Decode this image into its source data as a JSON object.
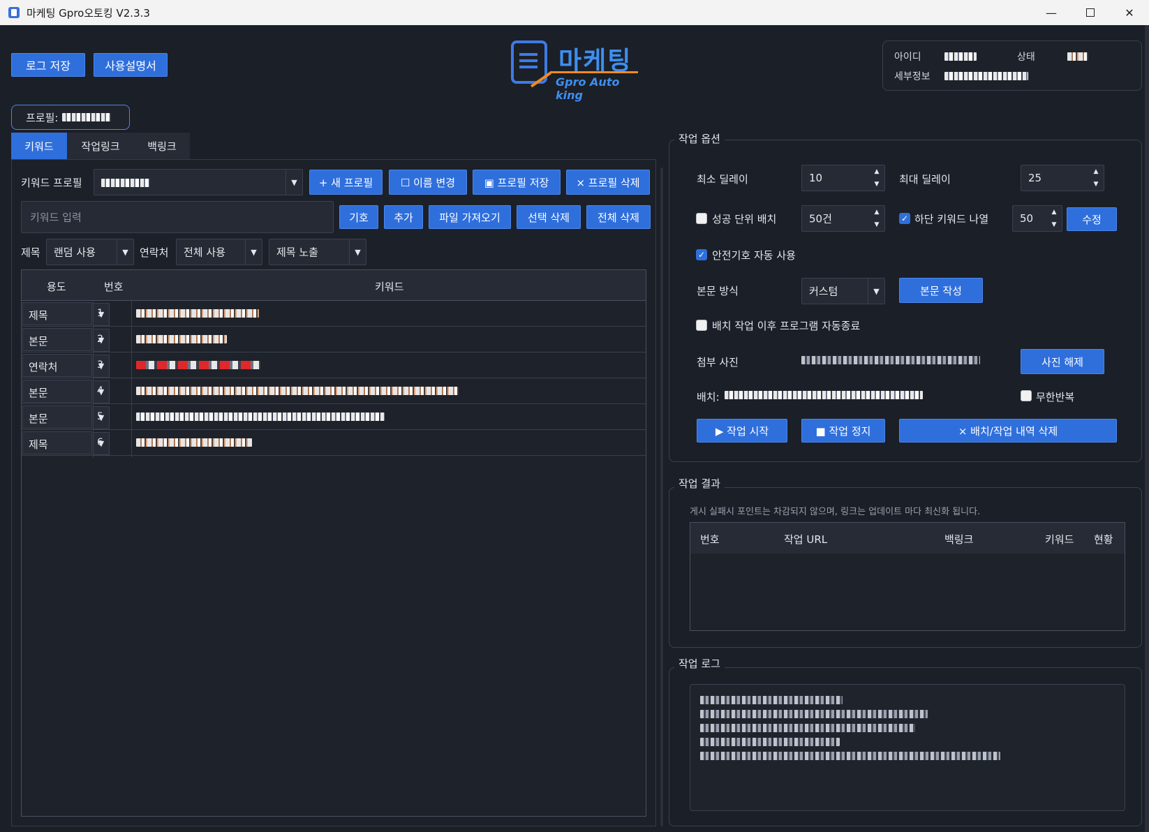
{
  "window": {
    "title": "마케팅 Gpro오토킹 V2.3.3",
    "min_glyph": "—",
    "close_glyph": "✕"
  },
  "toolbar": {
    "save_log": "로그 저장",
    "manual": "사용설명서"
  },
  "logo": {
    "word": "마케팅",
    "sub": "Gpro Auto king"
  },
  "account": {
    "id_label": "아이디",
    "status_label": "상태",
    "detail_label": "세부정보"
  },
  "profile": {
    "label": "프로필:"
  },
  "tabs": [
    {
      "label": "키워드"
    },
    {
      "label": "작업링크"
    },
    {
      "label": "백링크"
    }
  ],
  "keyword": {
    "profile_label": "키워드 프로필",
    "new_profile": "+ 새 프로필",
    "rename": "☐ 이름 변경",
    "save_profile": "▣ 프로필 저장",
    "delete_profile": "× 프로필 삭제",
    "input_placeholder": "키워드 입력",
    "symbol": "기호",
    "add": "추가",
    "import_file": "파일 가져오기",
    "delete_selected": "선택 삭제",
    "delete_all": "전체 삭제",
    "title_label": "제목",
    "title_value": "랜덤 사용",
    "contact_label": "연락처",
    "contact_value": "전체 사용",
    "exposure_value": "제목 노출",
    "columns": {
      "usage": "용도",
      "number": "번호",
      "keyword": "키워드"
    },
    "rows": [
      {
        "usage": "제목",
        "number": "1"
      },
      {
        "usage": "본문",
        "number": "2"
      },
      {
        "usage": "연락처",
        "number": "3"
      },
      {
        "usage": "본문",
        "number": "4"
      },
      {
        "usage": "본문",
        "number": "5"
      },
      {
        "usage": "제목",
        "number": "6"
      }
    ]
  },
  "options": {
    "title": "작업 옵션",
    "min_delay_label": "최소 딜레이",
    "min_delay": "10",
    "max_delay_label": "최대 딜레이",
    "max_delay": "25",
    "success_batch_label": "성공 단위 배치",
    "success_batch_value": "50건",
    "success_batch_checked": false,
    "bottom_keyword_label": "하단 키워드 나열",
    "bottom_keyword_checked": true,
    "bottom_keyword_value": "50",
    "modify": "수정",
    "safe_symbol_label": "안전기호 자동 사용",
    "safe_symbol_checked": true,
    "body_mode_label": "본문 방식",
    "body_mode_value": "커스텀",
    "write_body": "본문 작성",
    "auto_exit_label": "배치 작업 이후 프로그램 자동종료",
    "auto_exit_checked": false,
    "photo_label": "첨부 사진",
    "clear_photo": "사진 해제",
    "batch_label": "배치:",
    "infinite_label": "무한반복",
    "infinite_checked": false,
    "start": "▶ 작업 시작",
    "stop": "■ 작업 정지",
    "delete_history": "× 배치/작업 내역 삭제"
  },
  "results": {
    "title": "작업 결과",
    "notice": "게시 실패시 포인트는 차감되지 않으며, 링크는 업데이트 마다 최신화 됩니다.",
    "columns": {
      "number": "번호",
      "url": "작업 URL",
      "backlink": "백링크",
      "keyword": "키워드",
      "status": "현황"
    }
  },
  "log": {
    "title": "작업 로그"
  },
  "colors": {
    "accent": "#2f6fdc",
    "background": "#1b1f27",
    "logo_orange": "#f08a24"
  },
  "icons": [
    "app-icon",
    "document-icon",
    "checkbox-checked-icon",
    "dropdown-arrow-icon",
    "spin-up-icon",
    "spin-down-icon"
  ]
}
